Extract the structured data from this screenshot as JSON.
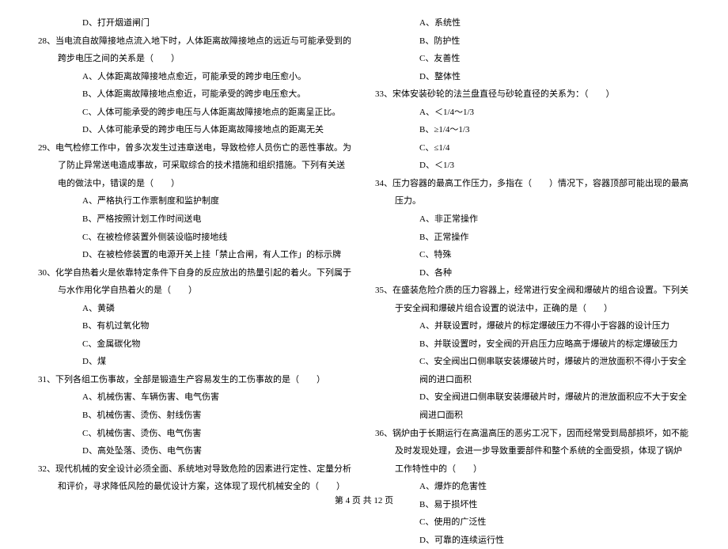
{
  "left": {
    "opt27d": "D、打开烟道闸门",
    "q28": "28、当电流自故障接地点流入地下时，人体距离故障接地点的远近与可能承受到的跨步电压之间的关系是（　　）",
    "q28a": "A、人体距离故障接地点愈近，可能承受的跨步电压愈小。",
    "q28b": "B、人体距离故障接地点愈近，可能承受的跨步电压愈大。",
    "q28c": "C、人体可能承受的跨步电压与人体距离故障接地点的距离呈正比。",
    "q28d": "D、人体可能承受的跨步电压与人体距离故障接地点的距离无关",
    "q29": "29、电气检修工作中，曾多次发生过违章送电，导致检修人员伤亡的恶性事故。为了防止异常送电造成事故，可采取综合的技术措施和组织措施。下列有关送电的做法中，错误的是（　　）",
    "q29a": "A、严格执行工作票制度和监护制度",
    "q29b": "B、严格按照计划工作时间送电",
    "q29c": "C、在被检修装置外侧装设临时接地线",
    "q29d": "D、在被检修装置的电源开关上挂「禁止合闸，有人工作」的标示牌",
    "q30": "30、化学自热着火是依靠特定条件下自身的反应放出的热量引起的着火。下列属于与水作用化学自热着火的是（　　）",
    "q30a": "A、黄磷",
    "q30b": "B、有机过氧化物",
    "q30c": "C、金属碳化物",
    "q30d": "D、煤",
    "q31": "31、下列各组工伤事故，全部是锻造生产容易发生的工伤事故的是（　　）",
    "q31a": "A、机械伤害、车辆伤害、电气伤害",
    "q31b": "B、机械伤害、烫伤、射线伤害",
    "q31c": "C、机械伤害、烫伤、电气伤害",
    "q31d": "D、高处坠落、烫伤、电气伤害",
    "q32": "32、现代机械的安全设计必须全面、系统地对导致危险的因素进行定性、定量分析和评价，寻求降低风险的最优设计方案，这体现了现代机械安全的（　　）"
  },
  "right": {
    "q32a": "A、系统性",
    "q32b": "B、防护性",
    "q32c": "C、友善性",
    "q32d": "D、整体性",
    "q33": "33、宋体安装砂轮的法兰盘直径与砂轮直径的关系为：（　　）",
    "q33a": "A、＜1/4～1/3",
    "q33b": "B、≥1/4～1/3",
    "q33c": "C、≤1/4",
    "q33d": "D、＜1/3",
    "q34": "34、压力容器的最高工作压力，多指在（　　）情况下，容器顶部可能出现的最高压力。",
    "q34a": "A、非正常操作",
    "q34b": "B、正常操作",
    "q34c": "C、特殊",
    "q34d": "D、各种",
    "q35": "35、在盛装危险介质的压力容器上，经常进行安全阀和爆破片的组合设置。下列关于安全阀和爆破片组合设置的说法中，正确的是（　　）",
    "q35a": "A、并联设置时，爆破片的标定爆破压力不得小于容器的设计压力",
    "q35b": "B、并联设置时，安全阀的开启压力应略高于爆破片的标定爆破压力",
    "q35c": "C、安全阀出口侧串联安装爆破片时，爆破片的泄放面积不得小于安全阀的进口面积",
    "q35d": "D、安全阀进口侧串联安装爆破片时，爆破片的泄放面积应不大于安全阀进口面积",
    "q36": "36、锅炉由于长期运行在高温高压的恶劣工况下，因而经常受到局部损坏，如不能及时发现处理，会进一步导致重要部件和整个系统的全面受损，体现了锅炉工作特性中的（　　）",
    "q36a": "A、爆炸的危害性",
    "q36b": "B、易于损坏性",
    "q36c": "C、使用的广泛性",
    "q36d": "D、可靠的连续运行性"
  },
  "footer": "第 4 页 共 12 页"
}
